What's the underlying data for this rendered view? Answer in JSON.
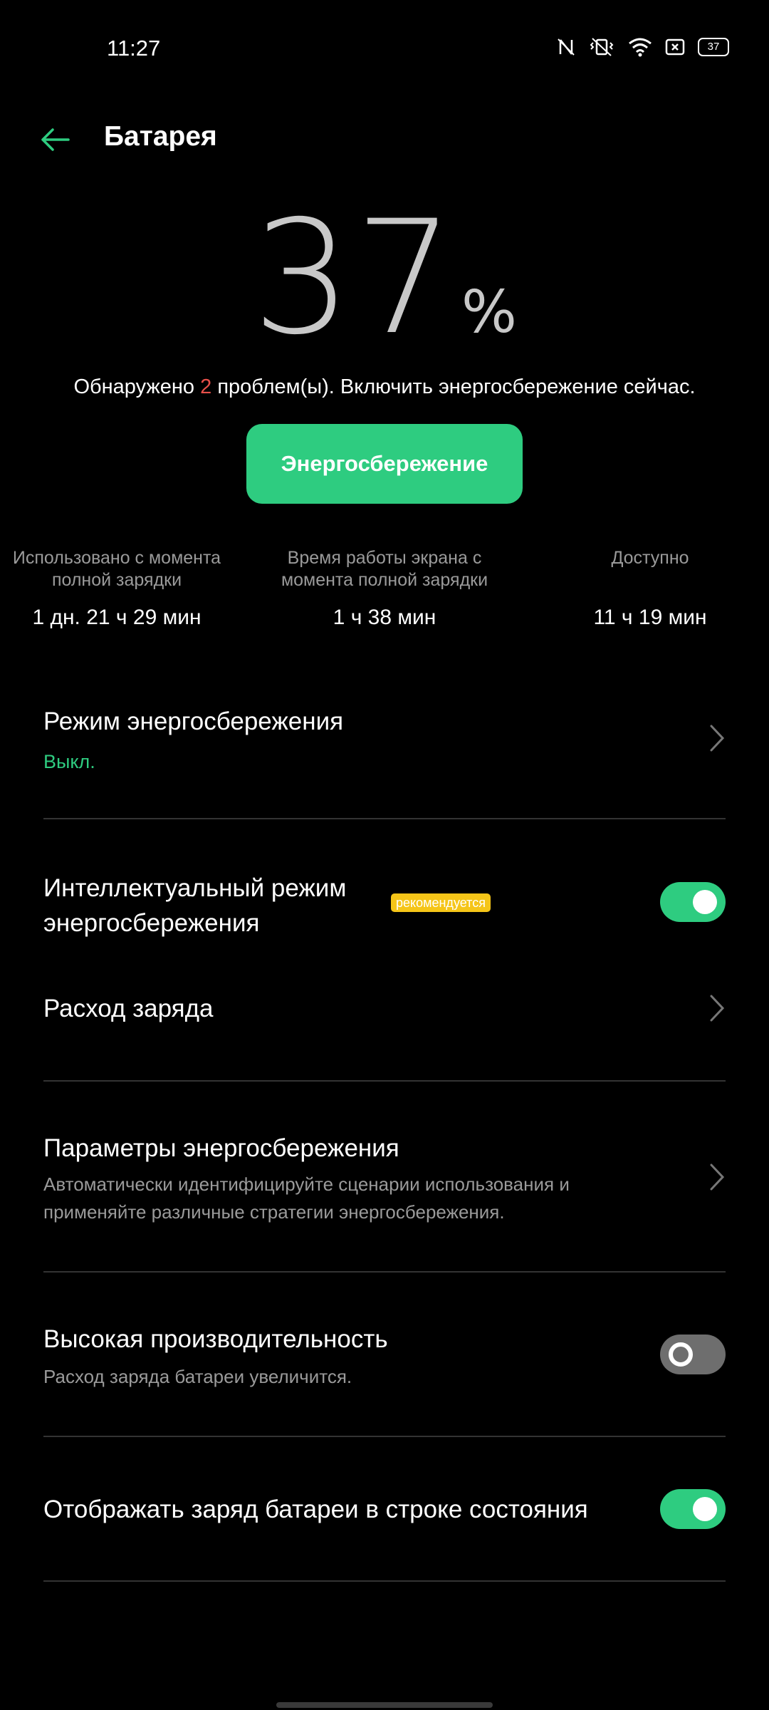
{
  "status_bar": {
    "time": "11:27",
    "battery_badge": "37"
  },
  "header": {
    "title": "Батарея"
  },
  "battery": {
    "percent": "37",
    "percent_sign": "%",
    "problem_prefix": "Обнаружено ",
    "problem_count": "2",
    "problem_suffix": " проблем(ы). Включить энергосбережение сейчас.",
    "save_button_label": "Энергосбережение"
  },
  "stats": [
    {
      "label": "Использовано с момента полной зарядки",
      "value": "1 дн. 21 ч 29 мин"
    },
    {
      "label": "Время работы экрана с момента полной зарядки",
      "value": "1 ч 38 мин"
    },
    {
      "label": "Доступно",
      "value": "11 ч 19 мин"
    }
  ],
  "settings": {
    "power_saving_mode": {
      "title": "Режим энергосбережения",
      "status": "Выкл."
    },
    "smart_power_saving": {
      "title_line1": "Интеллектуальный режим",
      "title_line2": "энергосбережения",
      "badge": "рекомендуется",
      "enabled": true
    },
    "battery_usage": {
      "title": "Расход заряда"
    },
    "power_saving_params": {
      "title": "Параметры энергосбережения",
      "subtitle_line1": "Автоматически идентифицируйте сценарии использования и",
      "subtitle_line2": "применяйте различные стратегии энергосбережения."
    },
    "high_performance": {
      "title": "Высокая производительность",
      "subtitle": "Расход заряда батареи увеличится.",
      "enabled": false
    },
    "show_battery_status_bar": {
      "title": "Отображать заряд батареи в строке состояния",
      "enabled": true
    }
  },
  "colors": {
    "accent": "#2ecc80",
    "warning_number": "#e8504a",
    "badge": "#f5c518",
    "background": "#000000"
  }
}
